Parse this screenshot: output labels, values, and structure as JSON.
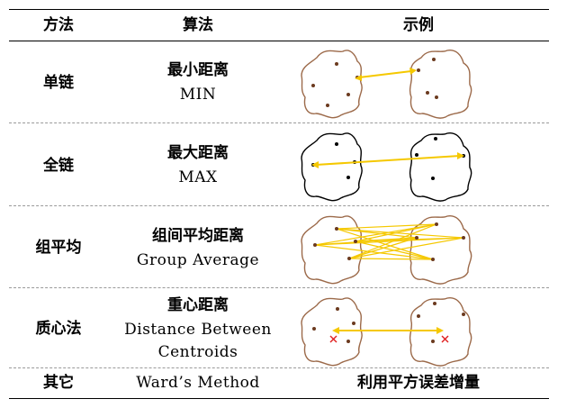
{
  "header": {
    "method": "方法",
    "algorithm": "算法",
    "example": "示例"
  },
  "rows": [
    {
      "method": "单链",
      "algo_cn": "最小距离",
      "algo_en": "MIN"
    },
    {
      "method": "全链",
      "algo_cn": "最大距离",
      "algo_en": "MAX"
    },
    {
      "method": "组平均",
      "algo_cn": "组间平均距离",
      "algo_en": "Group Average"
    },
    {
      "method": "质心法",
      "algo_cn": "重心距离",
      "algo_en": "Distance Between",
      "algo_en2": "Centroids"
    },
    {
      "method": "其它",
      "algo_en": "Ward’s Method",
      "example_text": "利用平方误差增量"
    }
  ],
  "colors": {
    "brown_outline": "#9c6a4a",
    "black_outline": "#000000",
    "arrow": "#f5c800",
    "centroid_cross": "#e02020",
    "point": "#6b3a1f"
  }
}
